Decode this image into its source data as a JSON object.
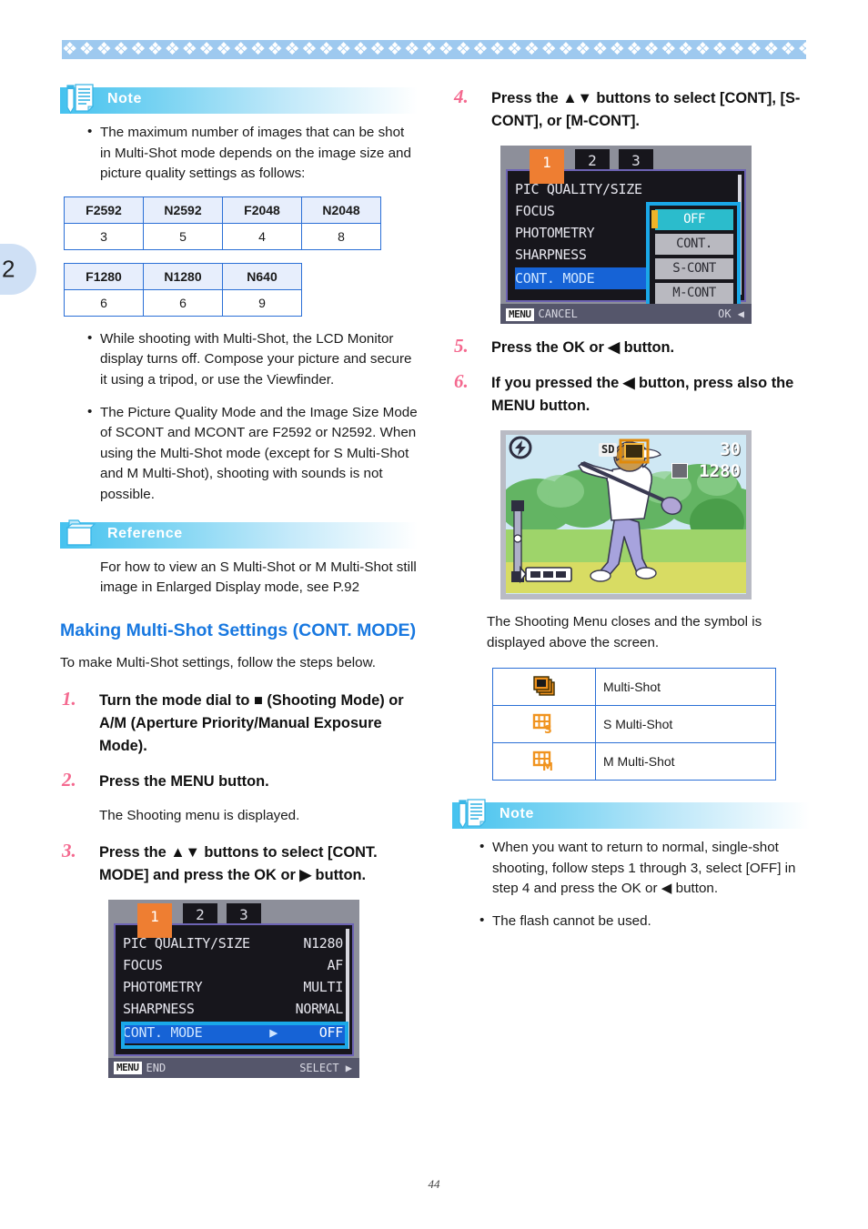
{
  "page": {
    "number": "44",
    "chapter_tab": "2",
    "top_rule_glyph": "❖"
  },
  "left_column": {
    "note1": {
      "label": "Note",
      "icon": "note-pencil-document-icon",
      "bullets": [
        "The maximum number of images that can be shot in Multi-Shot mode depends on the image size and picture quality settings as follows:",
        "While shooting with Multi-Shot, the LCD Monitor display turns off. Compose your picture and secure it using a tripod, or use the Viewfinder.",
        "The Picture Quality Mode and the Image Size Mode of SCONT and MCONT are F2592 or N2592. When using the Multi-Shot mode (except for S Multi-Shot and M Multi-Shot), shooting with sounds is not possible."
      ],
      "table_a": {
        "headers": [
          "F2592",
          "N2592",
          "F2048",
          "N2048"
        ],
        "values": [
          "3",
          "5",
          "4",
          "8"
        ]
      },
      "table_b": {
        "headers": [
          "F1280",
          "N1280",
          "N640"
        ],
        "values": [
          "6",
          "6",
          "9"
        ]
      }
    },
    "reference": {
      "label": "Reference",
      "icon": "folder-icon",
      "body": "For how to view an S Multi-Shot or M Multi-Shot still image in Enlarged Display mode, see P.92"
    },
    "section": {
      "heading": "Making Multi-Shot Settings (CONT. MODE)",
      "lead": "To make Multi-Shot settings, follow the steps below."
    },
    "steps": [
      {
        "num": "1.",
        "text_parts": [
          "Turn the mode dial to ",
          "■",
          " (Shooting Mode) or A/M (Aperture Priority/Manual Exposure Mode)."
        ],
        "full_text": "Turn the mode dial to ■ (Shooting Mode) or A/M (Aperture Priority/Manual Exposure Mode)."
      },
      {
        "num": "2.",
        "full_text": "Press the MENU button.",
        "sub_note": "The Shooting menu is displayed."
      },
      {
        "num": "3.",
        "full_text": "Press the ▲▼ buttons to select [CONT. MODE] and press the OK or ▶ button."
      }
    ],
    "lcd_menu": {
      "tabs": [
        "1",
        "2",
        "3"
      ],
      "active_tab": "1",
      "rows": [
        {
          "label": "PIC QUALITY/SIZE",
          "value": "N1280"
        },
        {
          "label": "FOCUS",
          "value": "AF"
        },
        {
          "label": "PHOTOMETRY",
          "value": "MULTI"
        },
        {
          "label": "SHARPNESS",
          "value": "NORMAL"
        },
        {
          "label": "CONT. MODE",
          "value": "OFF",
          "selected": true,
          "arrow": "▶"
        }
      ],
      "status_left_chip": "MENU",
      "status_left": "END",
      "status_right": "SELECT ▶"
    }
  },
  "right_column": {
    "steps": [
      {
        "num": "4.",
        "full_text": "Press the ▲▼ buttons to select [CONT], [S-CONT], or [M-CONT]."
      },
      {
        "num": "5.",
        "full_text": "Press the OK or ◀ button."
      },
      {
        "num": "6.",
        "full_text": "If you pressed the ◀ button, press also the MENU button."
      }
    ],
    "lcd_menu": {
      "tabs": [
        "1",
        "2",
        "3"
      ],
      "active_tab": "1",
      "rows": [
        {
          "label": "PIC QUALITY/SIZE"
        },
        {
          "label": "FOCUS"
        },
        {
          "label": "PHOTOMETRY"
        },
        {
          "label": "SHARPNESS"
        },
        {
          "label": "CONT. MODE",
          "selected": true,
          "arrow": "◀"
        }
      ],
      "options": [
        "OFF",
        "CONT.",
        "S-CONT",
        "M-CONT"
      ],
      "selected_option": "OFF",
      "status_left_chip": "MENU",
      "status_left": "CANCEL",
      "status_right": "OK ◀"
    },
    "photo_lcd": {
      "overlay_sd": "SD",
      "overlay_count": "30",
      "overlay_size": "1280",
      "description": "golfer-swinging-club-photo"
    },
    "result_text": "The Shooting Menu closes and the symbol is displayed above the screen.",
    "symbol_table": [
      {
        "icon": "multi-shot-stack-icon",
        "label": "Multi-Shot"
      },
      {
        "icon": "s-multi-shot-grid-icon",
        "label": "S Multi-Shot"
      },
      {
        "icon": "m-multi-shot-grid-icon",
        "label": "M Multi-Shot"
      }
    ],
    "note2": {
      "label": "Note",
      "icon": "note-pencil-document-icon",
      "bullets": [
        "When you want to return to normal, single-shot shooting, follow steps 1 through 3, select [OFF] in step 4 and press the OK or ◀ button.",
        "The flash cannot be used."
      ]
    }
  },
  "colors": {
    "heading_blue": "#1878e0",
    "step_number_pink": "#f4698f",
    "callout_cyan": "#45c2ef",
    "table_border_blue": "#2a6fd6",
    "table_header_fill": "#e7eefc",
    "lcd_orange": "#ee7e32",
    "lcd_select_blue": "#1663d6",
    "symbol_orange": "#f0931e",
    "chapter_tab_fill": "#cfe0f5"
  }
}
